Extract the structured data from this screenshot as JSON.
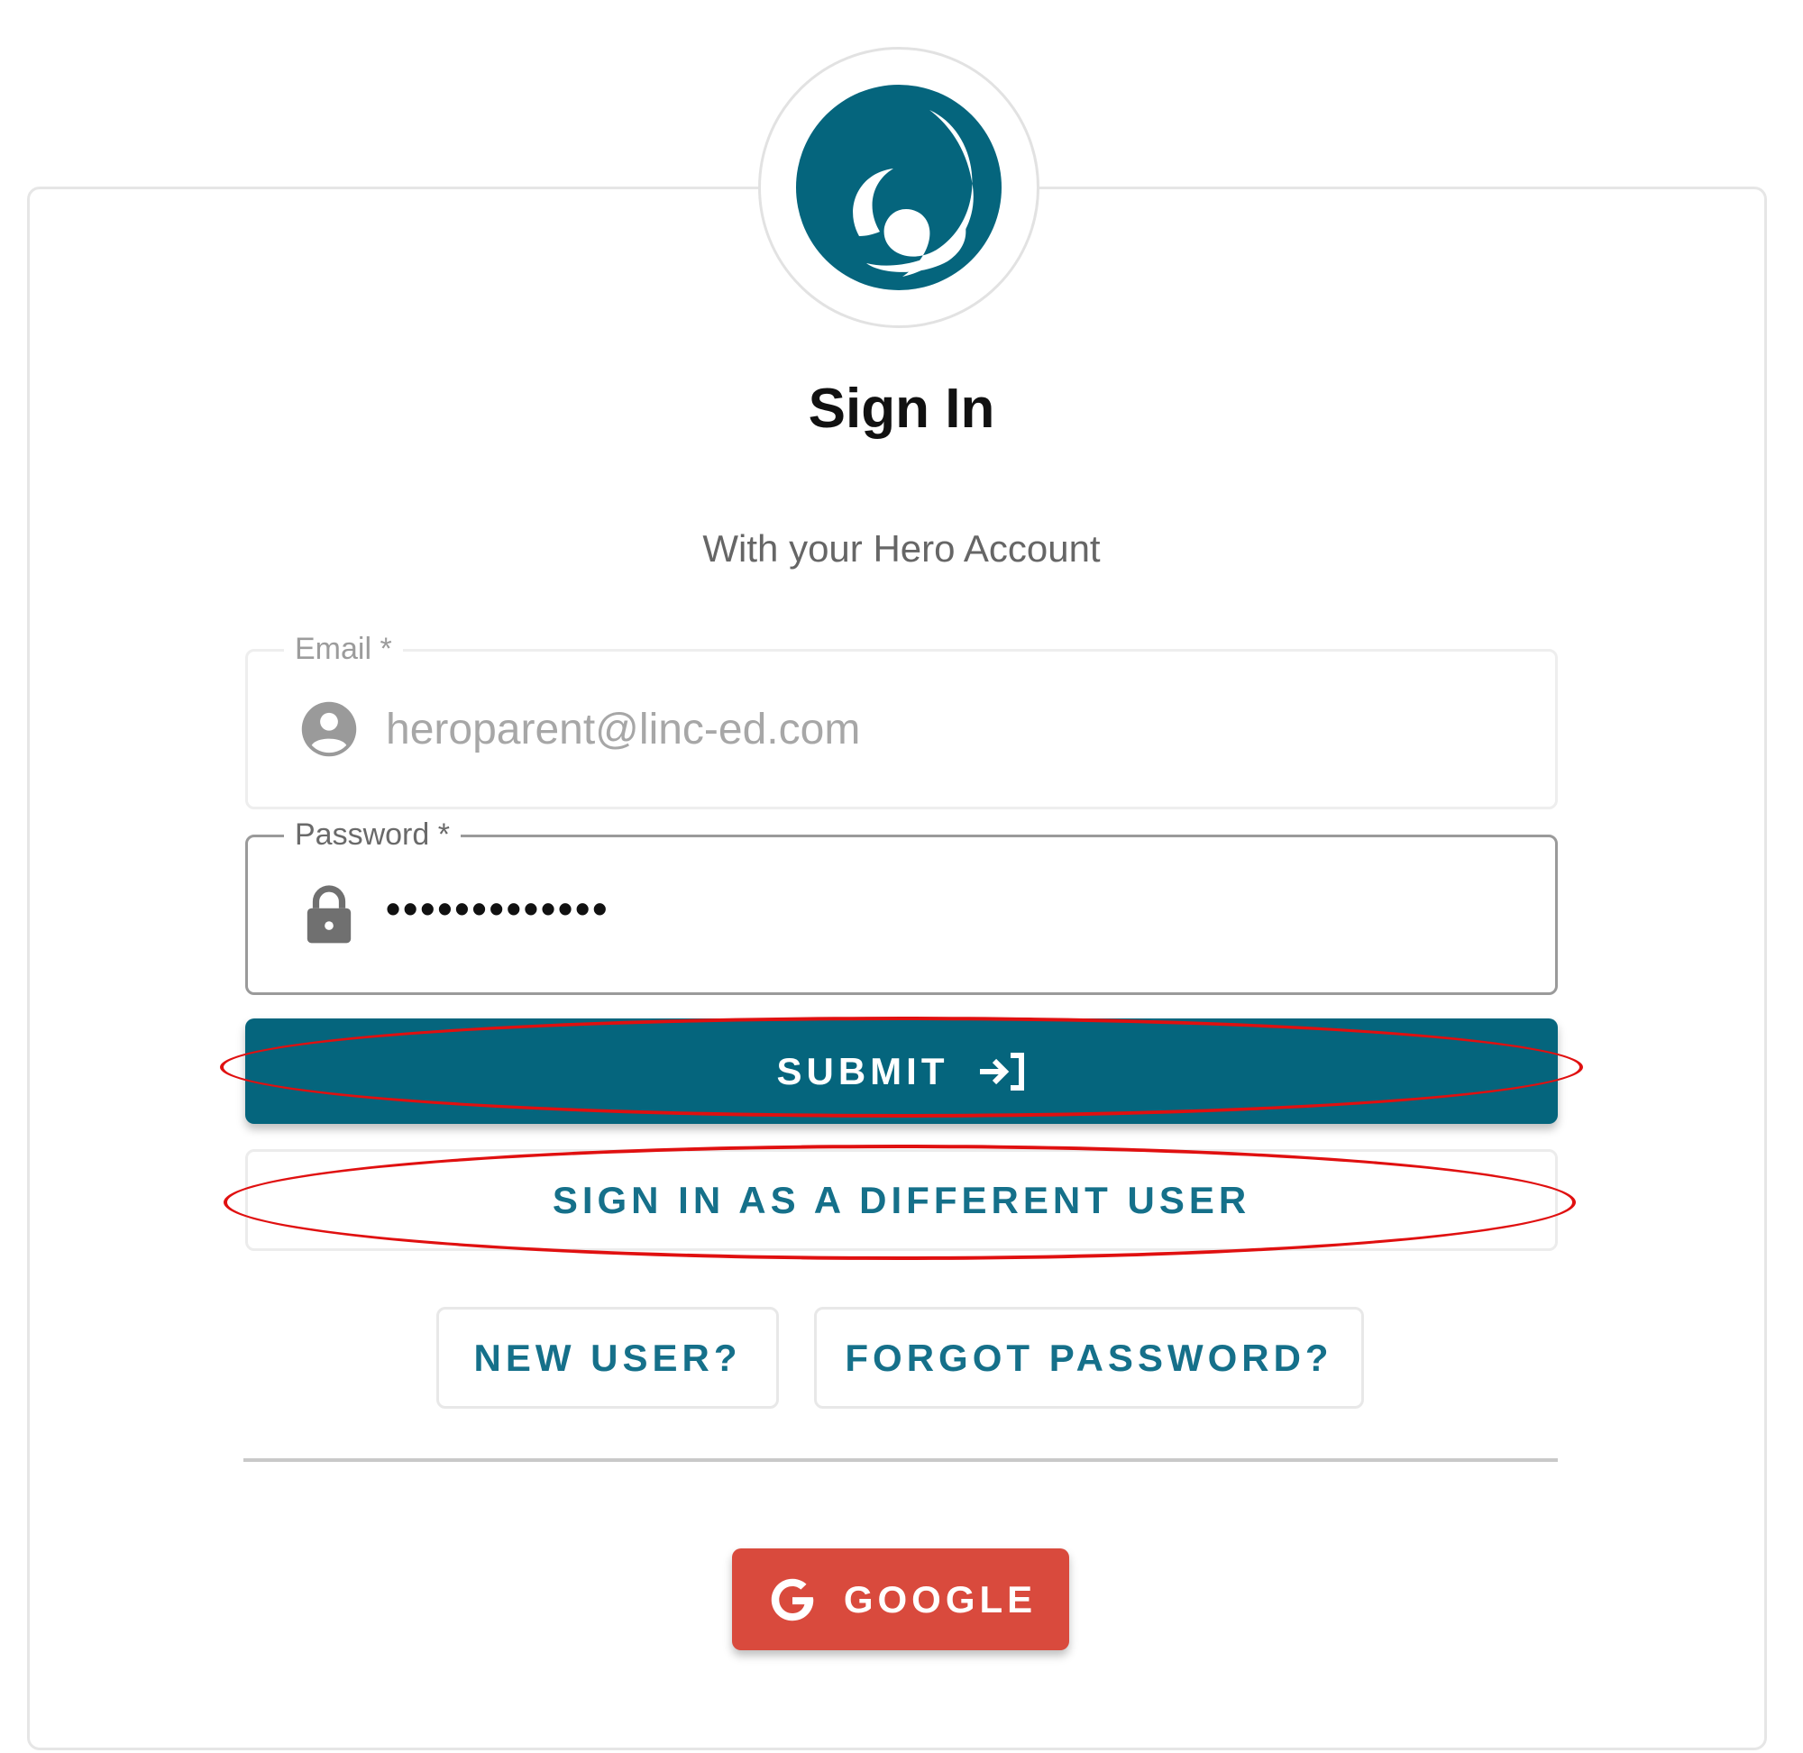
{
  "card": {
    "title": "Sign In",
    "subtitle": "With your Hero Account"
  },
  "email": {
    "label": "Email *",
    "value": "heroparent@linc-ed.com",
    "icon": "account-circle-icon"
  },
  "password": {
    "label": "Password *",
    "value": "•••••••••••••",
    "icon": "lock-icon"
  },
  "buttons": {
    "submit": "SUBMIT",
    "different_user": "SIGN IN AS A DIFFERENT USER",
    "new_user": "NEW USER?",
    "forgot_password": "FORGOT PASSWORD?",
    "google": "GOOGLE"
  },
  "colors": {
    "brand": "#05657d",
    "link": "#15708a",
    "google": "#d94a3d",
    "annotation": "#e01010"
  }
}
